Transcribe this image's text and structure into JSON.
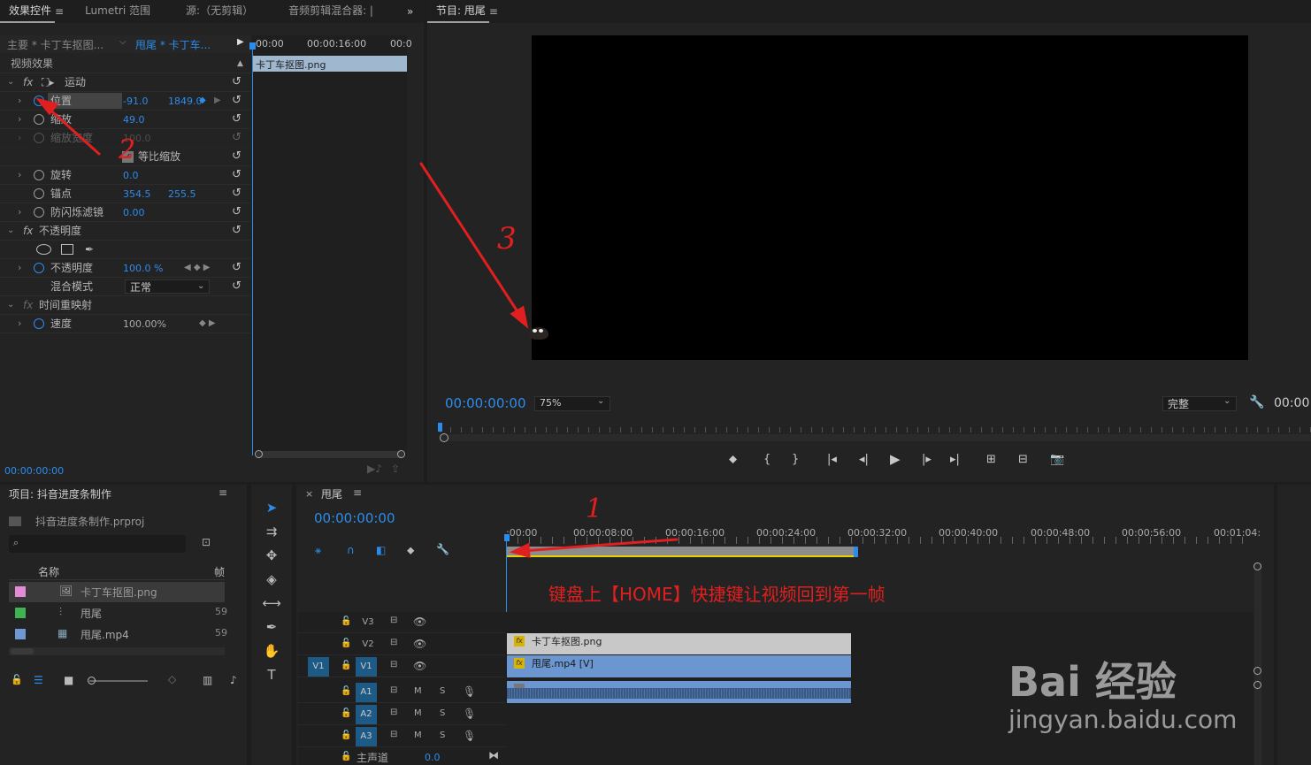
{
  "effect_controls": {
    "tabs": [
      "效果控件",
      "Lumetri 范围",
      "源:（无剪辑）",
      "音频剪辑混合器: |"
    ],
    "master_label": "主要 * 卡丁车抠图...",
    "sequence_label": "甩尾 * 卡丁车...",
    "ruler": [
      "00:00",
      "00:00:16:00",
      "00:0"
    ],
    "clip_label": "卡丁车抠图.png",
    "section_video": "视频效果",
    "motion": "运动",
    "position_label": "位置",
    "position_x": "-91.0",
    "position_y": "1849.0",
    "scale_label": "缩放",
    "scale_val": "49.0",
    "scale_width_label": "缩放宽度",
    "scale_width_val": "100.0",
    "uniform_label": "等比缩放",
    "rotation_label": "旋转",
    "rotation_val": "0.0",
    "anchor_label": "锚点",
    "anchor_x": "354.5",
    "anchor_y": "255.5",
    "flicker_label": "防闪烁滤镜",
    "flicker_val": "0.00",
    "opacity_section": "不透明度",
    "opacity_label": "不透明度",
    "opacity_val": "100.0 %",
    "blend_label": "混合模式",
    "blend_val": "正常",
    "time_remap": "时间重映射",
    "speed_label": "速度",
    "speed_val": "100.00%",
    "timecode": "00:00:00:00"
  },
  "program": {
    "title": "节目: 甩尾",
    "timecode": "00:00:00:00",
    "zoom": "75%",
    "quality": "完整",
    "timecode_right": "00:00:"
  },
  "project": {
    "title": "项目: 抖音进度条制作",
    "file": "抖音进度条制作.prproj",
    "search_placeholder": "",
    "col_name": "名称",
    "col_fr": "帧",
    "items": [
      {
        "name": "卡丁车抠图.png",
        "color": "#e58ad6",
        "fr": ""
      },
      {
        "name": "甩尾",
        "color": "#3fb34f",
        "fr": "59"
      },
      {
        "name": "甩尾.mp4",
        "color": "#6f97d6",
        "fr": "59"
      }
    ]
  },
  "timeline": {
    "title": "甩尾",
    "timecode": "00:00:00:00",
    "ruler": [
      ":00:00",
      "00:00:08:00",
      "00:00:16:00",
      "00:00:24:00",
      "00:00:32:00",
      "00:00:40:00",
      "00:00:48:00",
      "00:00:56:00",
      "00:01:04:"
    ],
    "tracks": [
      "V3",
      "V2",
      "V1",
      "A1",
      "A2",
      "A3"
    ],
    "source_v": "V1",
    "clip_v2": "卡丁车抠图.png",
    "clip_v1": "甩尾.mp4 [V]",
    "master_label": "主声道",
    "master_val": "0.0",
    "m_label": "M",
    "s_label": "S"
  },
  "annotations": {
    "num1": "1",
    "num2": "2",
    "num3": "3",
    "caption": "键盘上【HOME】快捷键让视频回到第一帧"
  },
  "watermark": {
    "brand": "Bai 经验",
    "url": "jingyan.baidu.com"
  },
  "colors": {
    "accent": "#2d8ceb",
    "annotation": "#e02020",
    "clip_png": "#c8c8c8",
    "clip_video": "#6b96cf"
  }
}
